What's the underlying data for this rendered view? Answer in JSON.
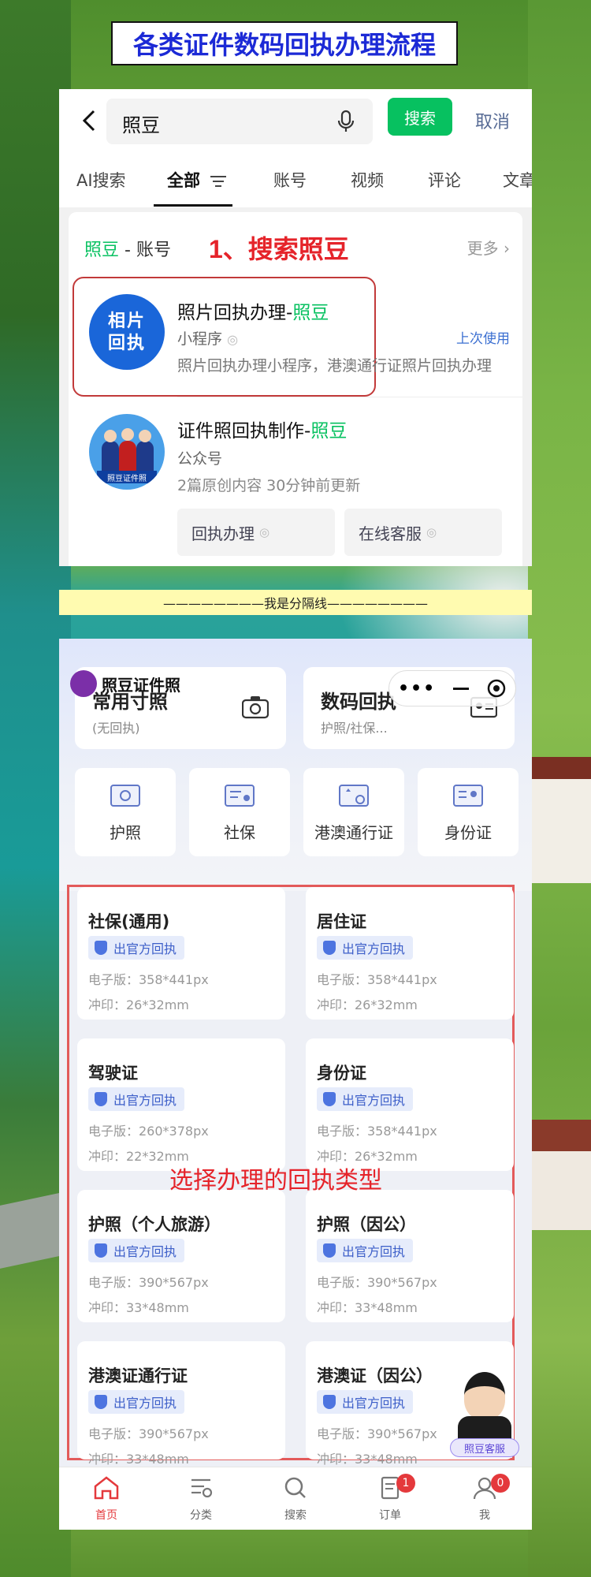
{
  "banner": {
    "title": "各类证件数码回执办理流程"
  },
  "search": {
    "query": "照豆",
    "search_button": "搜索",
    "cancel": "取消",
    "tabs": [
      {
        "label": "AI搜索"
      },
      {
        "label": "全部"
      },
      {
        "label": "账号"
      },
      {
        "label": "视频"
      },
      {
        "label": "评论"
      },
      {
        "label": "文章"
      }
    ],
    "section": {
      "keyword": "照豆",
      "rest": " - 账号",
      "more": "更多"
    },
    "step_label": "1、搜索照豆",
    "results": [
      {
        "avatar_lines": [
          "相片",
          "回执"
        ],
        "title_prefix": "照片回执办理-",
        "title_kw": "照豆",
        "type": "小程序",
        "desc": "照片回执办理小程序，港澳通行证照片回执办理",
        "badge": "上次使用"
      },
      {
        "avatar_caption": "照豆证件照",
        "title_prefix": "证件照回执制作-",
        "title_kw": "照豆",
        "type": "公众号",
        "desc": "2篇原创内容  30分钟前更新",
        "buttons": [
          "回执办理",
          "在线客服"
        ]
      }
    ]
  },
  "separator": {
    "text": "————————我是分隔线————————"
  },
  "miniapp": {
    "brand": "照豆证件照",
    "top_cards": [
      {
        "title": "常用寸照",
        "sub": "(无回执)",
        "icon": "camera-icon"
      },
      {
        "title": "数码回执",
        "sub": "护照/社保...",
        "icon": "id-card-icon"
      }
    ],
    "categories": [
      {
        "label": "护照",
        "icon": "passport-icon"
      },
      {
        "label": "社保",
        "icon": "social-security-icon"
      },
      {
        "label": "港澳通行证",
        "icon": "travel-permit-icon"
      },
      {
        "label": "身份证",
        "icon": "id-card-icon"
      }
    ],
    "documents": [
      {
        "name": "社保(通用)",
        "badge": "出官方回执",
        "e": "电子版：358*441px",
        "p": "冲印：26*32mm"
      },
      {
        "name": "居住证",
        "badge": "出官方回执",
        "e": "电子版：358*441px",
        "p": "冲印：26*32mm"
      },
      {
        "name": "驾驶证",
        "badge": "出官方回执",
        "e": "电子版：260*378px",
        "p": "冲印：22*32mm"
      },
      {
        "name": "身份证",
        "badge": "出官方回执",
        "e": "电子版：358*441px",
        "p": "冲印：26*32mm"
      },
      {
        "name": "护照（个人旅游）",
        "badge": "出官方回执",
        "e": "电子版：390*567px",
        "p": "冲印：33*48mm"
      },
      {
        "name": "护照（因公）",
        "badge": "出官方回执",
        "e": "电子版：390*567px",
        "p": "冲印：33*48mm"
      },
      {
        "name": "港澳证通行证",
        "badge": "出官方回执",
        "e": "电子版：390*567px",
        "p": "冲印：33*48mm"
      },
      {
        "name": "港澳证（因公）",
        "badge": "出官方回执",
        "e": "电子版：390*567px",
        "p": "冲印：33*48mm"
      }
    ],
    "select_label": "选择办理的回执类型",
    "service_tag": "照豆客服",
    "nav": [
      {
        "label": "首页",
        "icon": "home-icon"
      },
      {
        "label": "分类",
        "icon": "category-icon"
      },
      {
        "label": "搜索",
        "icon": "search-icon"
      },
      {
        "label": "订单",
        "icon": "order-icon",
        "badge": "1"
      },
      {
        "label": "我",
        "icon": "profile-icon",
        "badge": "0"
      }
    ],
    "colors": {
      "accent": "#07c160",
      "highlight": "#e5232a",
      "nav_active": "#e4393c"
    }
  }
}
